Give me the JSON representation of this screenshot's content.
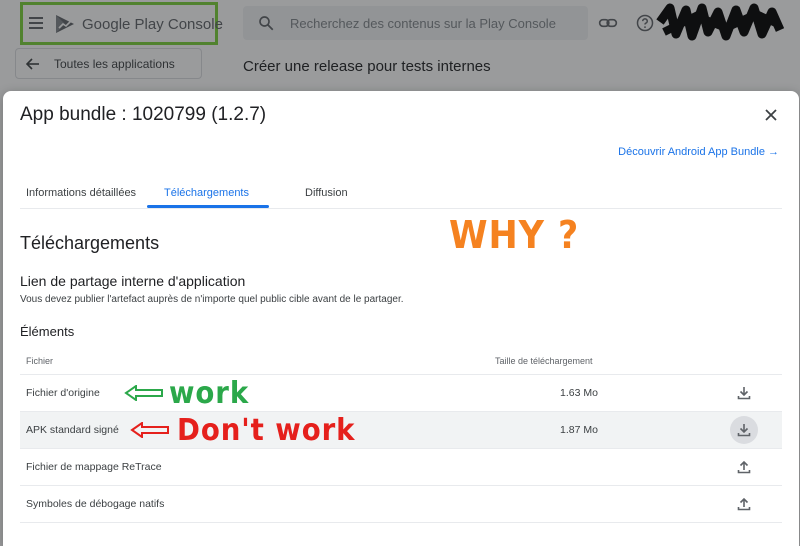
{
  "topbar": {
    "brand": "Google Play Console",
    "search_placeholder": "Recherchez des contenus sur la Play Console"
  },
  "background": {
    "back_label": "Toutes les applications",
    "heading": "Créer une release pour tests internes"
  },
  "dialog": {
    "title": "App bundle : 1020799 (1.2.7)",
    "discover_link": "Découvrir Android App Bundle →",
    "tabs": [
      {
        "label": "Informations détaillées",
        "active": false
      },
      {
        "label": "Téléchargements",
        "active": true
      },
      {
        "label": "Diffusion",
        "active": false
      }
    ],
    "section_title": "Téléchargements",
    "share_title": "Lien de partage interne d'application",
    "share_desc": "Vous devez publier l'artefact auprès de n'importe quel public cible avant de le partager.",
    "elements_title": "Éléments",
    "table": {
      "col_file": "Fichier",
      "col_size": "Taille de téléchargement",
      "rows": [
        {
          "name": "Fichier d'origine",
          "size": "1.63 Mo",
          "icon": "download-icon"
        },
        {
          "name": "APK standard signé",
          "size": "1.87 Mo",
          "icon": "download-icon"
        },
        {
          "name": "Fichier de mappage ReTrace",
          "size": "",
          "icon": "upload-icon"
        },
        {
          "name": "Symboles de débogage natifs",
          "size": "",
          "icon": "upload-icon"
        }
      ]
    }
  },
  "annotations": {
    "why": "WHY ?",
    "work": "work",
    "dont_work": "Don't work",
    "colors": {
      "why": "#f58220",
      "work": "#2ba84a",
      "dont_work": "#e5201c",
      "highlight_box": "#7ad23a"
    }
  }
}
